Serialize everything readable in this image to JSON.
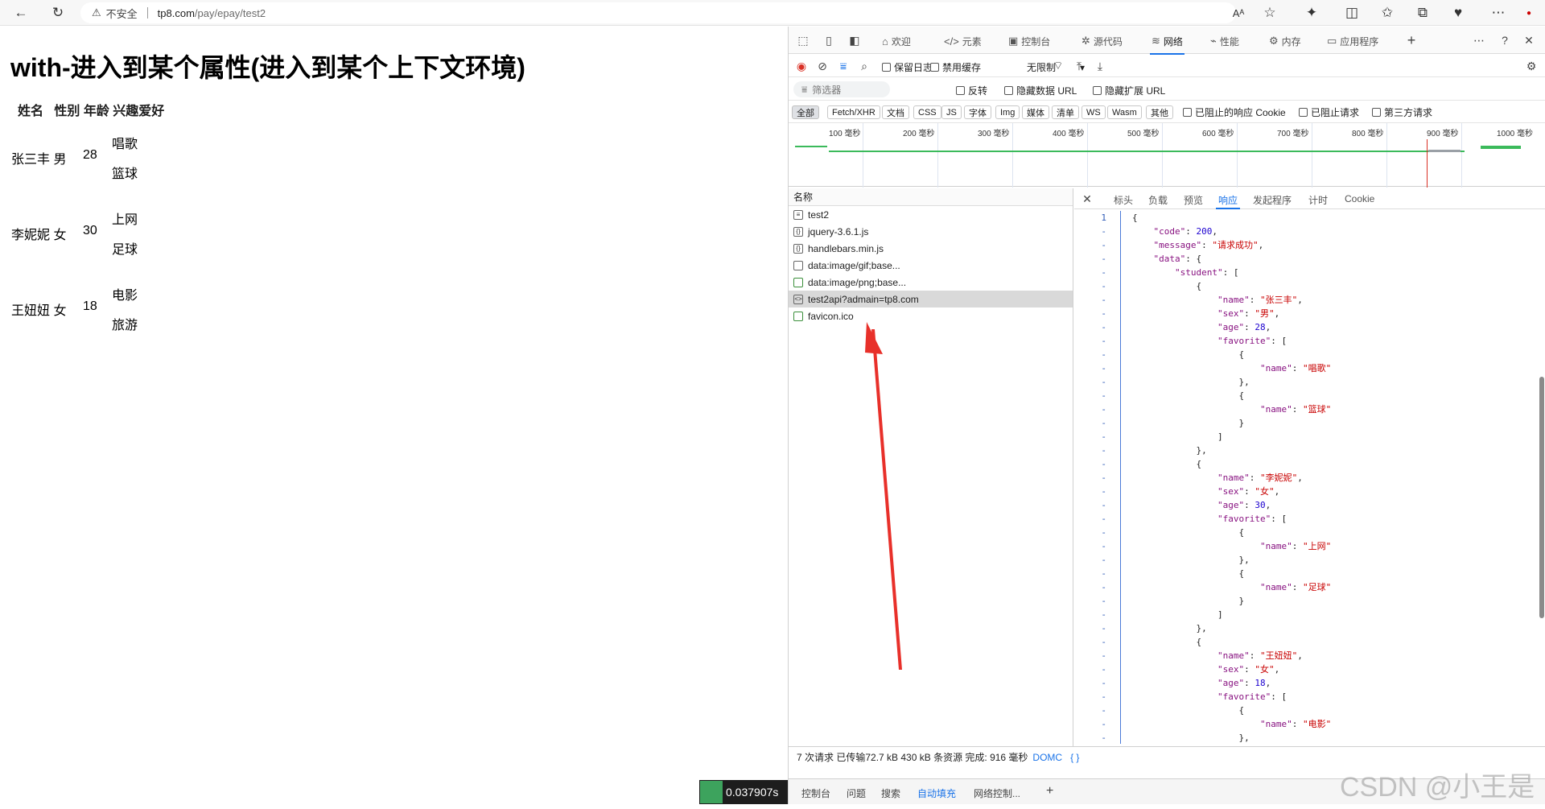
{
  "browser": {
    "security_label": "不安全",
    "url_host": "tp8.com",
    "url_path": "/pay/epay/test2"
  },
  "page": {
    "title": "with-进入到某个属性(进入到某个上下文环境)",
    "headers": [
      "姓名",
      "性别",
      "年龄",
      "兴趣爱好"
    ],
    "rows": [
      {
        "name": "张三丰",
        "sex": "男",
        "age": "28",
        "favs": [
          "唱歌",
          "篮球"
        ]
      },
      {
        "name": "李妮妮",
        "sex": "女",
        "age": "30",
        "favs": [
          "上网",
          "足球"
        ]
      },
      {
        "name": "王妞妞",
        "sex": "女",
        "age": "18",
        "favs": [
          "电影",
          "旅游"
        ]
      }
    ]
  },
  "devtools": {
    "tabs": [
      "欢迎",
      "元素",
      "控制台",
      "源代码",
      "网络",
      "性能",
      "内存",
      "应用程序"
    ],
    "active_tab": "网络",
    "toolbar": {
      "preserve_log": "保留日志",
      "disable_cache": "禁用缓存",
      "throttle": "无限制"
    },
    "filter": {
      "placeholder": "筛选器",
      "invert": "反转",
      "hide_data_url": "隐藏数据 URL",
      "hide_ext_url": "隐藏扩展 URL"
    },
    "type_filters": [
      "全部",
      "Fetch/XHR",
      "文档",
      "CSS",
      "JS",
      "字体",
      "Img",
      "媒体",
      "清单",
      "WS",
      "Wasm",
      "其他"
    ],
    "extra_filters": [
      "已阻止的响应 Cookie",
      "已阻止请求",
      "第三方请求"
    ],
    "timeline_ticks": [
      "100 毫秒",
      "200 毫秒",
      "300 毫秒",
      "400 毫秒",
      "500 毫秒",
      "600 毫秒",
      "700 毫秒",
      "800 毫秒",
      "900 毫秒",
      "1000 毫秒"
    ],
    "requests_header": "名称",
    "requests": [
      "test2",
      "jquery-3.6.1.js",
      "handlebars.min.js",
      "data:image/gif;base...",
      "data:image/png;base...",
      "test2api?admain=tp8.com",
      "favicon.ico"
    ],
    "detail_tabs": [
      "标头",
      "负载",
      "预览",
      "响应",
      "发起程序",
      "计时",
      "Cookie"
    ],
    "active_detail_tab": "响应",
    "response_lines": [
      "{",
      "    \"code\": 200,",
      "    \"message\": \"请求成功\",",
      "    \"data\": {",
      "        \"student\": [",
      "            {",
      "                \"name\": \"张三丰\",",
      "                \"sex\": \"男\",",
      "                \"age\": 28,",
      "                \"favorite\": [",
      "                    {",
      "                        \"name\": \"唱歌\"",
      "                    },",
      "                    {",
      "                        \"name\": \"篮球\"",
      "                    }",
      "                ]",
      "            },",
      "            {",
      "                \"name\": \"李妮妮\",",
      "                \"sex\": \"女\",",
      "                \"age\": 30,",
      "                \"favorite\": [",
      "                    {",
      "                        \"name\": \"上网\"",
      "                    },",
      "                    {",
      "                        \"name\": \"足球\"",
      "                    }",
      "                ]",
      "            },",
      "            {",
      "                \"name\": \"王妞妞\",",
      "                \"sex\": \"女\",",
      "                \"age\": 18,",
      "                \"favorite\": [",
      "                    {",
      "                        \"name\": \"电影\"",
      "                    },",
      "                    {"
    ],
    "status": "7 次请求  已传输72.7 kB  430 kB 条资源  完成: 916 毫秒",
    "status_link": "DOMC",
    "status_brace": "{ }",
    "drawer_tabs": [
      "控制台",
      "问题",
      "搜索",
      "自动填充",
      "网络控制..."
    ],
    "active_drawer_tab": "自动填充"
  },
  "timer": "0.037907s",
  "watermark": "CSDN @小王是",
  "colors": {
    "accent": "#1a73e8",
    "arrow": "#e8302a",
    "key": "#881280",
    "string": "#c80000",
    "number": "#1c00cf"
  }
}
